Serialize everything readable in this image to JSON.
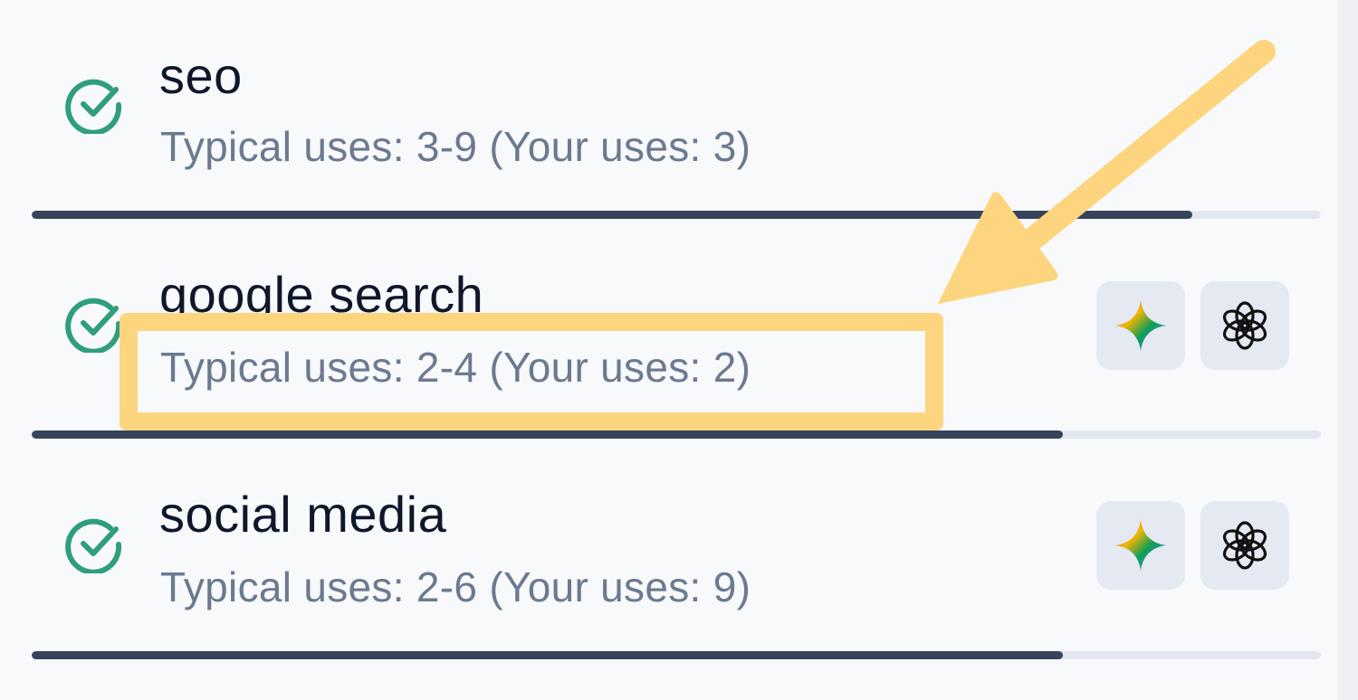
{
  "keywords": [
    {
      "name": "seo",
      "uses_text": "Typical uses: 3-9 (Your uses: 3)",
      "status_icon": "check-circle-icon",
      "progress": 0.9,
      "show_ai_buttons": false
    },
    {
      "name": "google search",
      "uses_text": "Typical uses: 2-4 (Your uses: 2)",
      "status_icon": "check-circle-icon",
      "progress": 0.8,
      "show_ai_buttons": true
    },
    {
      "name": "social media",
      "uses_text": "Typical uses: 2-6 (Your uses: 9)",
      "status_icon": "check-circle-icon",
      "progress": 0.8,
      "show_ai_buttons": true
    }
  ],
  "ai_buttons": [
    {
      "icon": "gemini-icon"
    },
    {
      "icon": "chatgpt-icon"
    }
  ],
  "colors": {
    "check": "#2f9e7d",
    "title": "#0f172a",
    "subtext": "#6b7a90",
    "progress_fill": "#36435a",
    "progress_track": "#e3e8f0",
    "annotation": "#fdd57f",
    "button_bg": "#e4e9f2"
  },
  "annotation": {
    "highlight": "google search uses text",
    "arrow": "pointing to highlighted text"
  }
}
